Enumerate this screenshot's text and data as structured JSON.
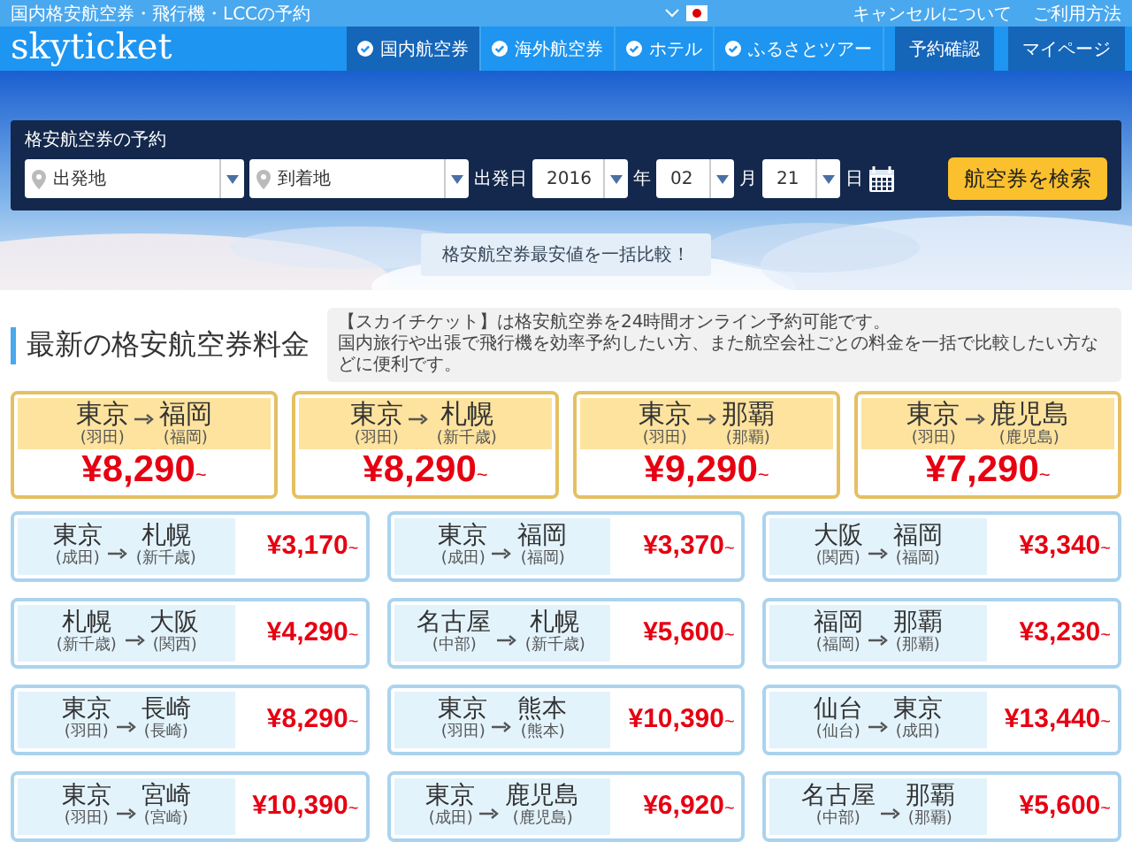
{
  "top_bar": {
    "tagline": "国内格安航空券・飛行機・LCCの予約",
    "links": [
      "キャンセルについて",
      "ご利用方法"
    ]
  },
  "header": {
    "logo": "skyticket",
    "nav": [
      {
        "label": "国内航空券",
        "selected": true
      },
      {
        "label": "海外航空券",
        "selected": false
      },
      {
        "label": "ホテル",
        "selected": false
      },
      {
        "label": "ふるさとツアー",
        "selected": false
      }
    ],
    "buttons": [
      "予約確認",
      "マイページ"
    ]
  },
  "search": {
    "title": "格安航空券の予約",
    "from": {
      "placeholder": "出発地"
    },
    "to": {
      "placeholder": "到着地"
    },
    "date_label": "出発日",
    "year": {
      "value": "2016",
      "unit": "年"
    },
    "month": {
      "value": "02",
      "unit": "月"
    },
    "day": {
      "value": "21",
      "unit": "日"
    },
    "submit": "航空券を検索"
  },
  "compare_button": "格安航空券最安値を一括比較！",
  "section": {
    "title": "最新の格安航空券料金",
    "description": [
      "【スカイチケット】は格安航空券を24時間オンライン予約可能です。",
      "国内旅行や出張で飛行機を効率予約したい方、また航空会社ごとの料金を一括で比較したい方などに便利です。"
    ]
  },
  "featured": [
    {
      "from": "東京",
      "from_airport": "(羽田)",
      "to": "福岡",
      "to_airport": "(福岡)",
      "price": "¥8,290",
      "suffix": "~"
    },
    {
      "from": "東京",
      "from_airport": "(羽田)",
      "to": "札幌",
      "to_airport": "(新千歳)",
      "price": "¥8,290",
      "suffix": "~"
    },
    {
      "from": "東京",
      "from_airport": "(羽田)",
      "to": "那覇",
      "to_airport": "(那覇)",
      "price": "¥9,290",
      "suffix": "~"
    },
    {
      "from": "東京",
      "from_airport": "(羽田)",
      "to": "鹿児島",
      "to_airport": "(鹿児島)",
      "price": "¥7,290",
      "suffix": "~"
    }
  ],
  "routes": [
    {
      "from": "東京",
      "from_airport": "(成田)",
      "to": "札幌",
      "to_airport": "(新千歳)",
      "price": "¥3,170",
      "suffix": "~"
    },
    {
      "from": "東京",
      "from_airport": "(成田)",
      "to": "福岡",
      "to_airport": "(福岡)",
      "price": "¥3,370",
      "suffix": "~"
    },
    {
      "from": "大阪",
      "from_airport": "(関西)",
      "to": "福岡",
      "to_airport": "(福岡)",
      "price": "¥3,340",
      "suffix": "~"
    },
    {
      "from": "札幌",
      "from_airport": "(新千歳)",
      "to": "大阪",
      "to_airport": "(関西)",
      "price": "¥4,290",
      "suffix": "~"
    },
    {
      "from": "名古屋",
      "from_airport": "(中部)",
      "to": "札幌",
      "to_airport": "(新千歳)",
      "price": "¥5,600",
      "suffix": "~"
    },
    {
      "from": "福岡",
      "from_airport": "(福岡)",
      "to": "那覇",
      "to_airport": "(那覇)",
      "price": "¥3,230",
      "suffix": "~"
    },
    {
      "from": "東京",
      "from_airport": "(羽田)",
      "to": "長崎",
      "to_airport": "(長崎)",
      "price": "¥8,290",
      "suffix": "~"
    },
    {
      "from": "東京",
      "from_airport": "(羽田)",
      "to": "熊本",
      "to_airport": "(熊本)",
      "price": "¥10,390",
      "suffix": "~"
    },
    {
      "from": "仙台",
      "from_airport": "(仙台)",
      "to": "東京",
      "to_airport": "(成田)",
      "price": "¥13,440",
      "suffix": "~"
    },
    {
      "from": "東京",
      "from_airport": "(羽田)",
      "to": "宮崎",
      "to_airport": "(宮崎)",
      "price": "¥10,390",
      "suffix": "~"
    },
    {
      "from": "東京",
      "from_airport": "(成田)",
      "to": "鹿児島",
      "to_airport": "(鹿児島)",
      "price": "¥6,920",
      "suffix": "~"
    },
    {
      "from": "名古屋",
      "from_airport": "(中部)",
      "to": "那覇",
      "to_airport": "(那覇)",
      "price": "¥5,600",
      "suffix": "~"
    }
  ]
}
